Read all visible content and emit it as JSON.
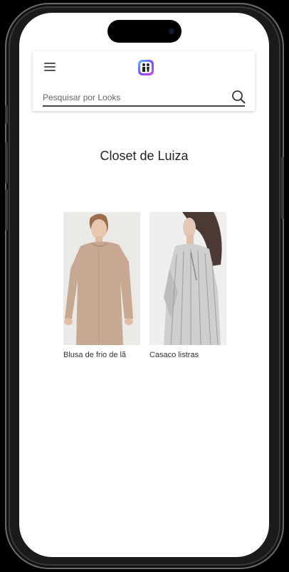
{
  "header": {
    "menu_icon": "hamburger-menu-icon",
    "logo_icon": "app-logo-icon",
    "search": {
      "placeholder": "Pesquisar por Looks",
      "value": "",
      "icon": "search-icon"
    }
  },
  "main": {
    "title": "Closet de Luiza",
    "items": [
      {
        "label": "Blusa de frio de lã"
      },
      {
        "label": "Casaco listras"
      }
    ]
  },
  "colors": {
    "accent_gradient": [
      "#4fc3f7",
      "#7c4dff",
      "#e040fb"
    ],
    "text": "#222222"
  }
}
